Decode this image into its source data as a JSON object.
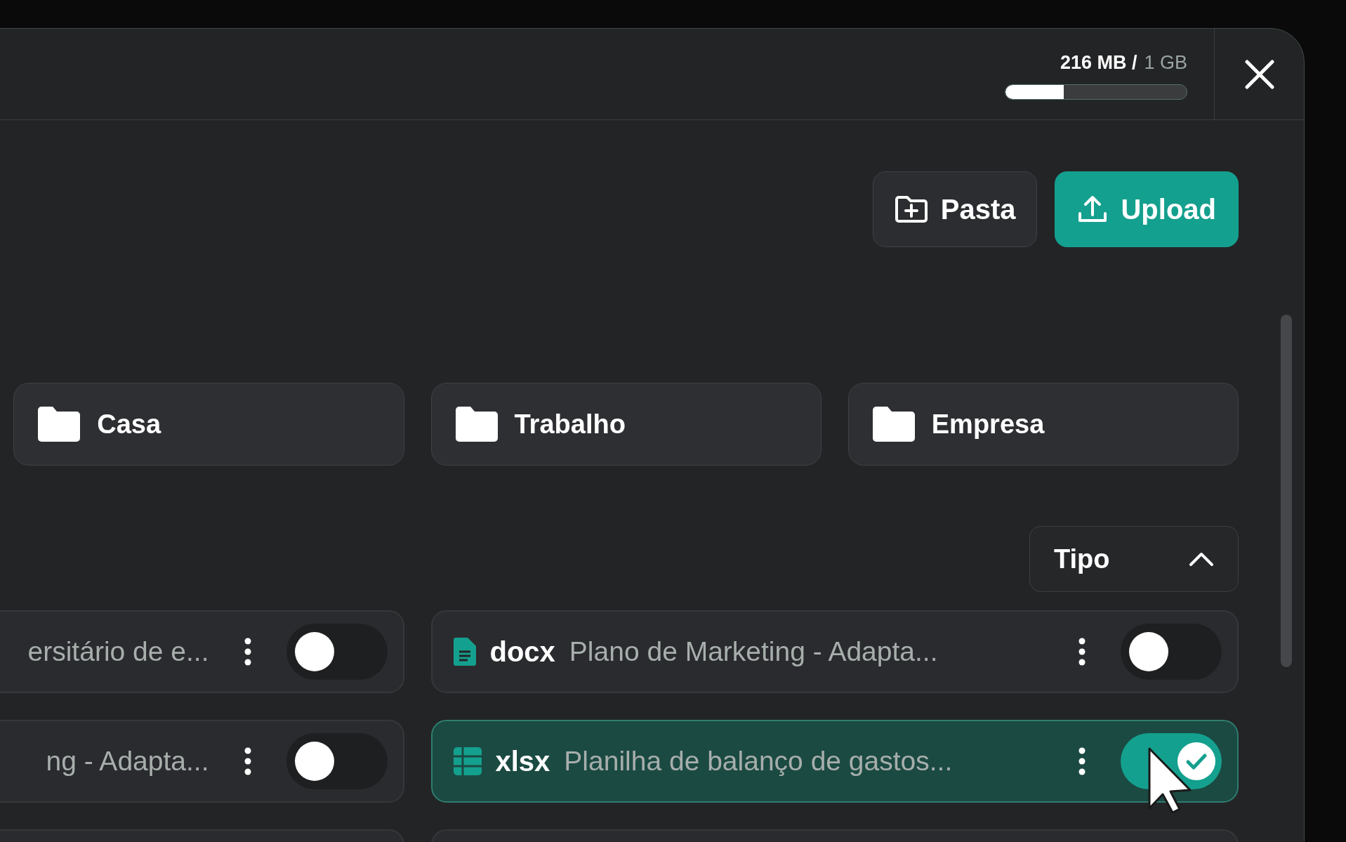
{
  "storage": {
    "used": "216 MB /",
    "total": "1 GB",
    "level": 0.32
  },
  "actions": [
    {
      "kind": "folder",
      "label": "Pasta"
    },
    {
      "kind": "upload",
      "label": "Upload"
    }
  ],
  "folders": [
    {
      "name": "Casa"
    },
    {
      "name": "Trabalho"
    },
    {
      "name": "Empresa"
    }
  ],
  "sort": {
    "label": "Tipo",
    "expanded": true
  },
  "files": [
    {
      "name": "ersitário de e...",
      "checked": false
    },
    {
      "kind": "document",
      "type": "docx",
      "name": "Plano de Marketing - Adapta...",
      "checked": false
    },
    {
      "name": "ng - Adapta...",
      "checked": false
    },
    {
      "kind": "spreadsheet",
      "type": "xlsx",
      "name": "Planilha de balanço de gastos...",
      "checked": true
    }
  ]
}
